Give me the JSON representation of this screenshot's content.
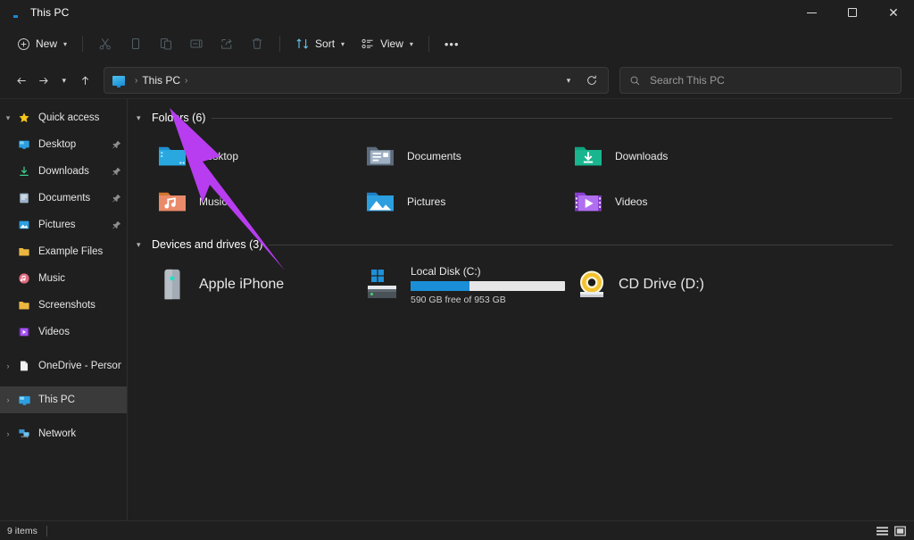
{
  "window": {
    "title": "This PC",
    "title_icon": "this-pc-monitor-icon",
    "controls": {
      "minimize": "–",
      "maximize": "□",
      "close": "✕"
    }
  },
  "toolbar": {
    "new_label": "New",
    "sort_label": "Sort",
    "view_label": "View",
    "overflow_label": "•••",
    "items": [
      {
        "name": "cut-button",
        "icon": "scissors-icon",
        "disabled": true
      },
      {
        "name": "copy-button",
        "icon": "copy-icon",
        "disabled": true
      },
      {
        "name": "paste-button",
        "icon": "paste-icon",
        "disabled": true
      },
      {
        "name": "rename-button",
        "icon": "rename-icon",
        "disabled": true
      },
      {
        "name": "share-button",
        "icon": "share-icon",
        "disabled": true
      },
      {
        "name": "delete-button",
        "icon": "trash-icon",
        "disabled": true
      }
    ]
  },
  "navigation": {
    "back_icon": "arrow-left-icon",
    "forward_icon": "arrow-right-icon",
    "recent_icon": "chevron-down-icon",
    "up_icon": "arrow-up-icon",
    "breadcrumb": {
      "icon": "this-pc-icon",
      "text": "This PC",
      "separator": "›",
      "leading_separator": "›"
    },
    "dropdown_icon": "chevron-down-icon",
    "refresh_icon": "refresh-icon"
  },
  "search": {
    "placeholder": "Search This PC",
    "value": "",
    "icon": "search-icon"
  },
  "sidebar": {
    "items": [
      {
        "label": "Quick access",
        "icon": "star-icon",
        "expander": "chevron-down",
        "level": 0,
        "pinned": false,
        "selected": false
      },
      {
        "label": "Desktop",
        "icon": "desktop-icon",
        "expander": "",
        "level": 1,
        "pinned": true,
        "selected": false
      },
      {
        "label": "Downloads",
        "icon": "downloads-icon",
        "expander": "",
        "level": 1,
        "pinned": true,
        "selected": false
      },
      {
        "label": "Documents",
        "icon": "documents-icon",
        "expander": "",
        "level": 1,
        "pinned": true,
        "selected": false
      },
      {
        "label": "Pictures",
        "icon": "pictures-icon",
        "expander": "",
        "level": 1,
        "pinned": true,
        "selected": false
      },
      {
        "label": "Example Files",
        "icon": "folder-icon",
        "expander": "",
        "level": 1,
        "pinned": false,
        "selected": false
      },
      {
        "label": "Music",
        "icon": "music-icon",
        "expander": "",
        "level": 1,
        "pinned": false,
        "selected": false
      },
      {
        "label": "Screenshots",
        "icon": "folder-icon",
        "expander": "",
        "level": 1,
        "pinned": false,
        "selected": false
      },
      {
        "label": "Videos",
        "icon": "videos-icon",
        "expander": "",
        "level": 1,
        "pinned": false,
        "selected": false
      },
      {
        "label": "OneDrive - Personal",
        "icon": "onedrive-icon",
        "expander": "chevron-right",
        "level": 0,
        "pinned": false,
        "selected": false
      },
      {
        "label": "This PC",
        "icon": "this-pc-icon",
        "expander": "chevron-right",
        "level": 0,
        "pinned": false,
        "selected": true
      },
      {
        "label": "Network",
        "icon": "network-icon",
        "expander": "chevron-right",
        "level": 0,
        "pinned": false,
        "selected": false
      }
    ],
    "pin_glyph": "📌"
  },
  "main": {
    "folders_section": {
      "header": "Folders (6)",
      "chevron": "chevron-down",
      "items": [
        {
          "label": "Desktop",
          "icon": "desktop-folder-icon"
        },
        {
          "label": "Documents",
          "icon": "documents-folder-icon"
        },
        {
          "label": "Downloads",
          "icon": "downloads-folder-icon"
        },
        {
          "label": "Music",
          "icon": "music-folder-icon"
        },
        {
          "label": "Pictures",
          "icon": "pictures-folder-icon"
        },
        {
          "label": "Videos",
          "icon": "videos-folder-icon"
        }
      ]
    },
    "devices_section": {
      "header": "Devices and drives (3)",
      "chevron": "chevron-down",
      "items": [
        {
          "label": "Apple iPhone",
          "icon": "portable-device-icon",
          "has_capacity_bar": false
        },
        {
          "label": "Local Disk (C:)",
          "icon": "windows-drive-icon",
          "has_capacity_bar": true,
          "capacity_text": "590 GB free of 953 GB",
          "used_percent": 38,
          "bar_fill_color": "#1a8fd8",
          "bar_track_color": "#e6e6e6"
        },
        {
          "label": "CD Drive (D:)",
          "icon": "cd-drive-icon",
          "has_capacity_bar": false
        }
      ]
    }
  },
  "annotation": {
    "type": "arrow",
    "color": "#b83df0",
    "points_to": "Apple iPhone"
  },
  "status_bar": {
    "items_count": "9 items",
    "view_details_icon": "details-view-icon",
    "view_large_icon": "large-icons-view-icon"
  }
}
